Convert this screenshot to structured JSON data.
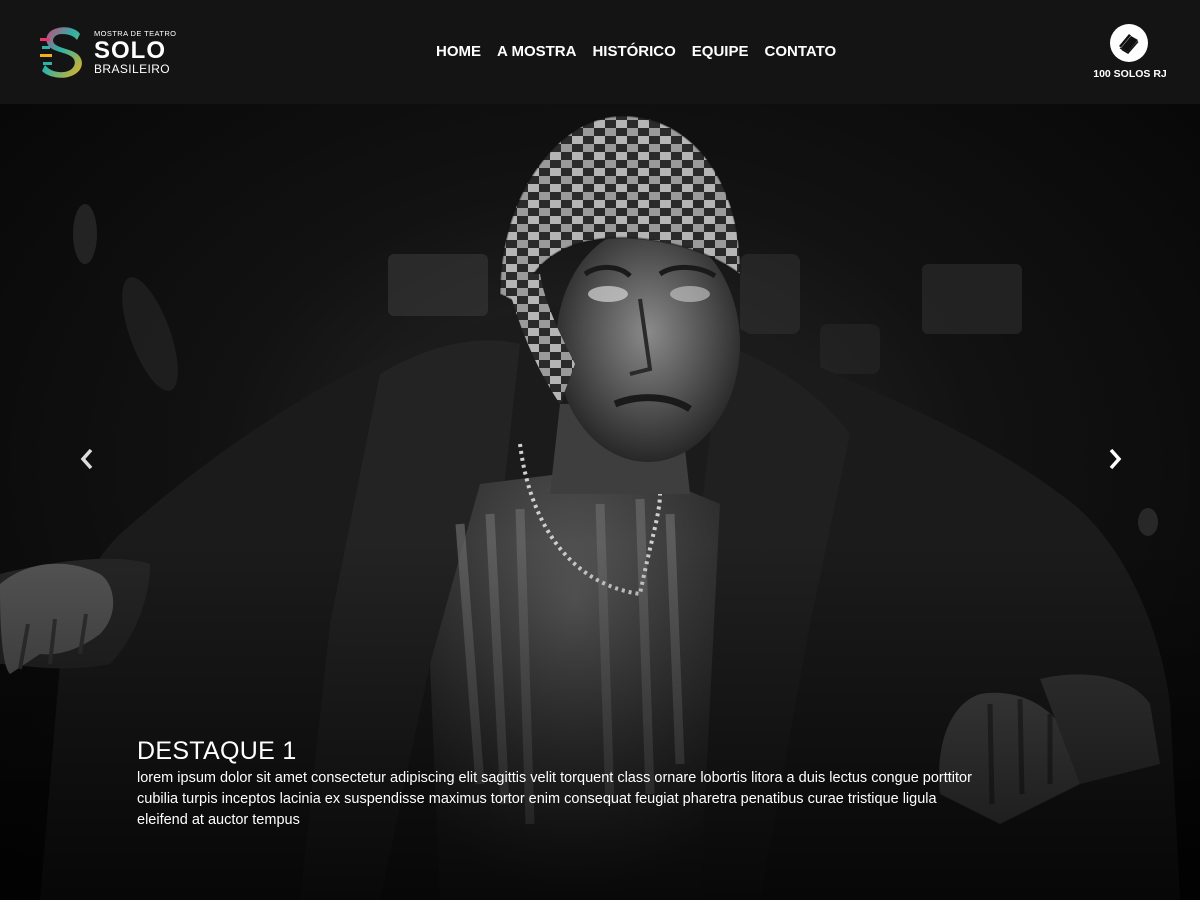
{
  "header": {
    "logo": {
      "subtitle": "MOSTRA DE TEATRO",
      "title": "SOLO",
      "bottom": "BRASILEIRO"
    },
    "nav": [
      {
        "label": "HOME"
      },
      {
        "label": "A MOSTRA"
      },
      {
        "label": "HISTÓRICO"
      },
      {
        "label": "EQUIPE"
      },
      {
        "label": "CONTATO"
      }
    ],
    "badge": {
      "label": "100 SOLOS RJ",
      "icon": "book-icon"
    }
  },
  "slider": {
    "prev_icon": "chevron-left-icon",
    "next_icon": "chevron-right-icon",
    "slide": {
      "title": "DESTAQUE 1",
      "text": "lorem ipsum dolor sit amet consectetur adipiscing elit sagittis velit torquent class ornare lobortis litora a duis lectus congue porttitor cubilia turpis inceptos lacinia ex suspendisse maximus tortor enim consequat feugiat pharetra penatibus curae tristique ligula eleifend at auctor tempus"
    }
  },
  "colors": {
    "header_bg": "#141414",
    "logo_pink": "#e63571",
    "logo_teal": "#2bb3a8",
    "logo_yellow": "#f2b21b",
    "text": "#ffffff"
  }
}
